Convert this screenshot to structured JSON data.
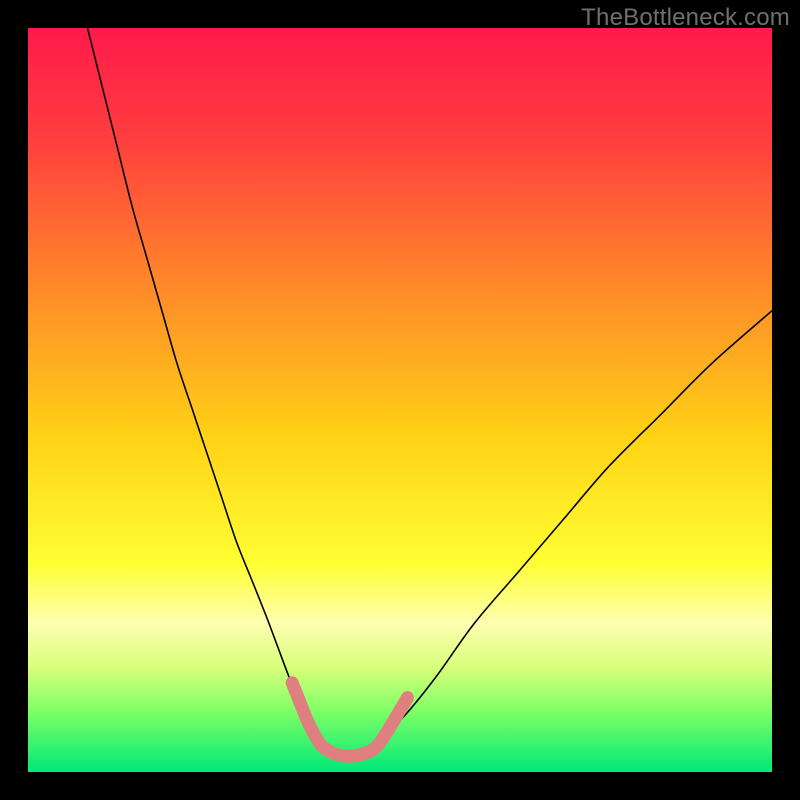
{
  "watermark": "TheBottleneck.com",
  "chart_data": {
    "type": "line",
    "title": "",
    "xlabel": "",
    "ylabel": "",
    "xlim": [
      0,
      100
    ],
    "ylim": [
      0,
      100
    ],
    "grid": false,
    "legend": false,
    "background_gradient": {
      "stops": [
        {
          "offset": 0.0,
          "color": "#ff1a4b"
        },
        {
          "offset": 0.15,
          "color": "#ff3e3e"
        },
        {
          "offset": 0.35,
          "color": "#ff8a29"
        },
        {
          "offset": 0.55,
          "color": "#ffd215"
        },
        {
          "offset": 0.72,
          "color": "#ffff33"
        },
        {
          "offset": 0.8,
          "color": "#fdffb0"
        },
        {
          "offset": 0.86,
          "color": "#d8ff7a"
        },
        {
          "offset": 0.92,
          "color": "#7bff66"
        },
        {
          "offset": 1.0,
          "color": "#00e878"
        }
      ]
    },
    "series": [
      {
        "name": "bottleneck_curve",
        "stroke": "#000000",
        "stroke_width": 1.6,
        "x": [
          8,
          10,
          12,
          14,
          16,
          18,
          20,
          22,
          24,
          26,
          28,
          30,
          32,
          33.5,
          35,
          37,
          38.5,
          40,
          42,
          44,
          46,
          48,
          51,
          55,
          60,
          66,
          72,
          78,
          85,
          92,
          100
        ],
        "y": [
          100,
          92,
          84,
          76,
          69,
          62,
          55,
          49,
          43,
          37,
          31,
          26,
          21,
          17,
          13,
          8,
          5,
          3,
          2,
          2,
          3,
          5,
          8,
          13,
          20,
          27,
          34,
          41,
          48,
          55,
          62
        ]
      },
      {
        "name": "highlight_band",
        "stroke": "#e07f7f",
        "stroke_width": 13,
        "linecap": "round",
        "x": [
          35.5,
          36.5,
          37.5,
          38.5,
          39.5,
          40.5,
          42,
          44,
          46,
          47,
          48,
          49,
          50,
          51
        ],
        "y": [
          12,
          9.5,
          7,
          5,
          3.5,
          2.8,
          2.2,
          2.2,
          2.8,
          3.6,
          5,
          6.6,
          8.3,
          10
        ]
      }
    ]
  }
}
